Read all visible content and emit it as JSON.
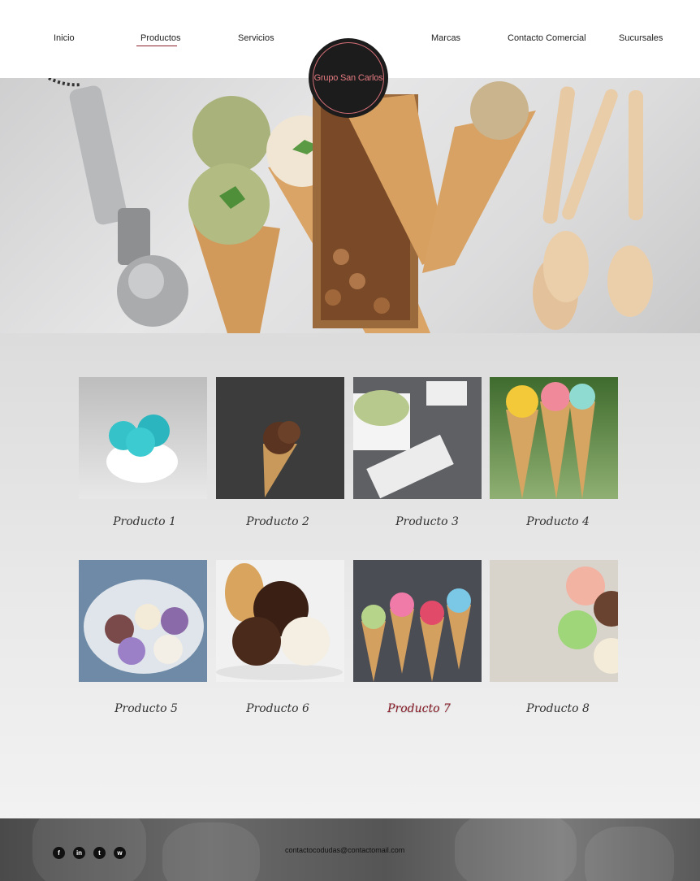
{
  "nav": {
    "items": [
      {
        "label": "Inicio"
      },
      {
        "label": "Productos"
      },
      {
        "label": "Servicios"
      },
      {
        "label": "Marcas"
      },
      {
        "label": "Contacto Comercial"
      },
      {
        "label": "Sucursales"
      }
    ],
    "active": "Productos"
  },
  "logo": {
    "text": "Grupo San Carlos"
  },
  "products": [
    {
      "label": "Producto 1"
    },
    {
      "label": "Producto 2"
    },
    {
      "label": "Producto 3"
    },
    {
      "label": "Producto 4"
    },
    {
      "label": "Producto 5"
    },
    {
      "label": "Producto 6"
    },
    {
      "label": "Producto 7"
    },
    {
      "label": "Producto 8"
    }
  ],
  "footer": {
    "social": [
      {
        "icon": "facebook-icon"
      },
      {
        "icon": "linkedin-icon"
      },
      {
        "icon": "twitter-icon"
      },
      {
        "icon": "whatsapp-icon"
      }
    ],
    "email": "contactocodudas@contactomail.com"
  },
  "colors": {
    "accent": "#8b1f2a",
    "logo_bg": "#1c1c1c",
    "logo_text": "#e37a80"
  }
}
